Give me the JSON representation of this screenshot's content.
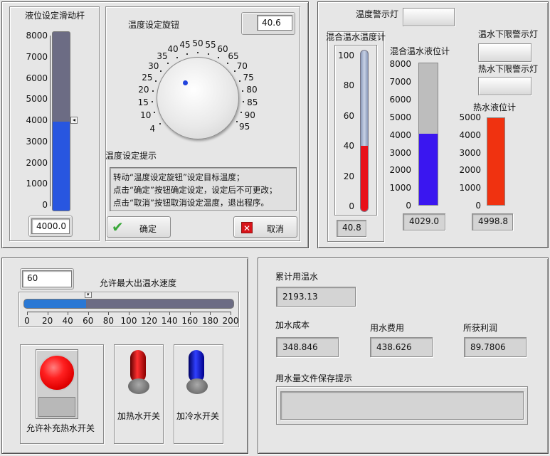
{
  "level_slider": {
    "label": "液位设定滑动杆",
    "ticks": [
      "8000",
      "7000",
      "6000",
      "5000",
      "4000",
      "3000",
      "2000",
      "1000",
      "0"
    ],
    "value": 4000.0,
    "max": 8000,
    "display": "4000.0",
    "fill_color": "#2856e0"
  },
  "temp_knob": {
    "label": "温度设定旋钮",
    "value_display": "40.6",
    "ticks": [
      "4",
      "10",
      "15",
      "20",
      "25",
      "30",
      "35",
      "40",
      "45",
      "50",
      "55",
      "60",
      "65",
      "70",
      "75",
      "80",
      "85",
      "90",
      "95"
    ]
  },
  "temp_hint": {
    "label": "温度设定提示",
    "lines": [
      "转动“温度设定旋钮”设定目标温度；",
      "点击“确定”按钮确定设定，设定后不可更改；",
      "点击“取消”按钮取消设定温度，退出程序。"
    ]
  },
  "ok_button": {
    "label": "确定"
  },
  "cancel_button": {
    "label": "取消"
  },
  "temp_alarm": {
    "label": "温度警示灯"
  },
  "mix_thermo": {
    "label": "混合温水温度计",
    "ticks": [
      "100",
      "80",
      "60",
      "40",
      "20",
      "0"
    ],
    "value": 40.8,
    "max": 100,
    "display": "40.8",
    "fill_color": "#e8101a"
  },
  "mix_level": {
    "label": "混合温水液位计",
    "ticks": [
      "8000",
      "7000",
      "6000",
      "5000",
      "4000",
      "3000",
      "2000",
      "1000",
      "0"
    ],
    "value": 4029.0,
    "max": 8000,
    "display": "4029.0",
    "fill_color": "#3a16f0"
  },
  "warm_low_alarm": {
    "label": "温水下限警示灯"
  },
  "hot_low_alarm": {
    "label": "热水下限警示灯"
  },
  "hot_level": {
    "label": "热水液位计",
    "ticks": [
      "5000",
      "4000",
      "3000",
      "2000",
      "1000",
      "0"
    ],
    "value": 4998.8,
    "max": 5000,
    "display": "4998.8",
    "fill_color": "#f03210"
  },
  "speed": {
    "value_display": "60",
    "label": "允许最大出温水速度",
    "value": 60,
    "max": 200,
    "ticks": [
      "0",
      "20",
      "40",
      "60",
      "80",
      "100",
      "120",
      "140",
      "160",
      "180",
      "200"
    ]
  },
  "switches": {
    "refill_label": "允许补充热水开关",
    "hot_label": "加热水开关",
    "cold_label": "加冷水开关"
  },
  "stats": {
    "total_label": "累计用温水",
    "total_value": "2193.13",
    "cost_label": "加水成本",
    "cost_value": "348.846",
    "fee_label": "用水费用",
    "fee_value": "438.626",
    "profit_label": "所获利润",
    "profit_value": "89.7806",
    "save_label": "用水量文件保存提示",
    "save_value": ""
  }
}
